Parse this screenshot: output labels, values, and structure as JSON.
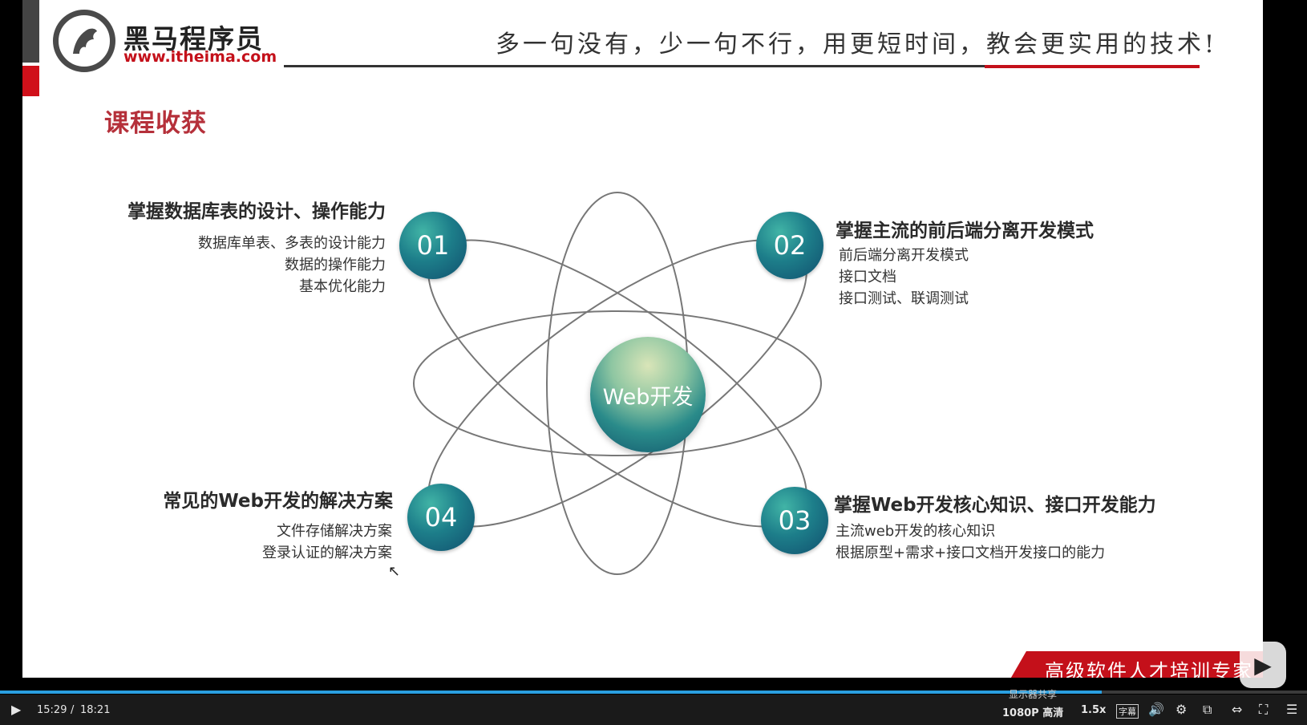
{
  "header": {
    "brand_cn": "黑马程序员",
    "brand_url": "www.itheima.com",
    "slogan": "多一句没有，少一句不行，用更短时间，教会更实用的技术!"
  },
  "section_title": "课程收获",
  "center_label": "Web开发",
  "items": [
    {
      "number": "01",
      "heading": "掌握数据库表的设计、操作能力",
      "lines": [
        "数据库单表、多表的设计能力",
        "数据的操作能力",
        "基本优化能力"
      ]
    },
    {
      "number": "02",
      "heading": "掌握主流的前后端分离开发模式",
      "lines": [
        "前后端分离开发模式",
        "接口文档",
        "接口测试、联调测试"
      ]
    },
    {
      "number": "03",
      "heading": "掌握Web开发核心知识、接口开发能力",
      "lines": [
        "主流web开发的核心知识",
        "根据原型+需求+接口文档开发接口的能力"
      ]
    },
    {
      "number": "04",
      "heading": "常见的Web开发的解决方案",
      "lines": [
        "文件存储解决方案",
        "登录认证的解决方案"
      ]
    }
  ],
  "banner": "高级软件人才培训专家",
  "player": {
    "current_time": "15:29",
    "separator": "/",
    "total_time": "18:21",
    "progress": 0.843,
    "quality": "1080P 高清",
    "speed": "1.5x",
    "subtitle": "字幕",
    "monitor_label": "显示器共享"
  },
  "colors": {
    "accent_red": "#c4101a",
    "title_red": "#b5303a",
    "teal": "#1d7e8a",
    "progress_blue": "#2a9fe0"
  }
}
